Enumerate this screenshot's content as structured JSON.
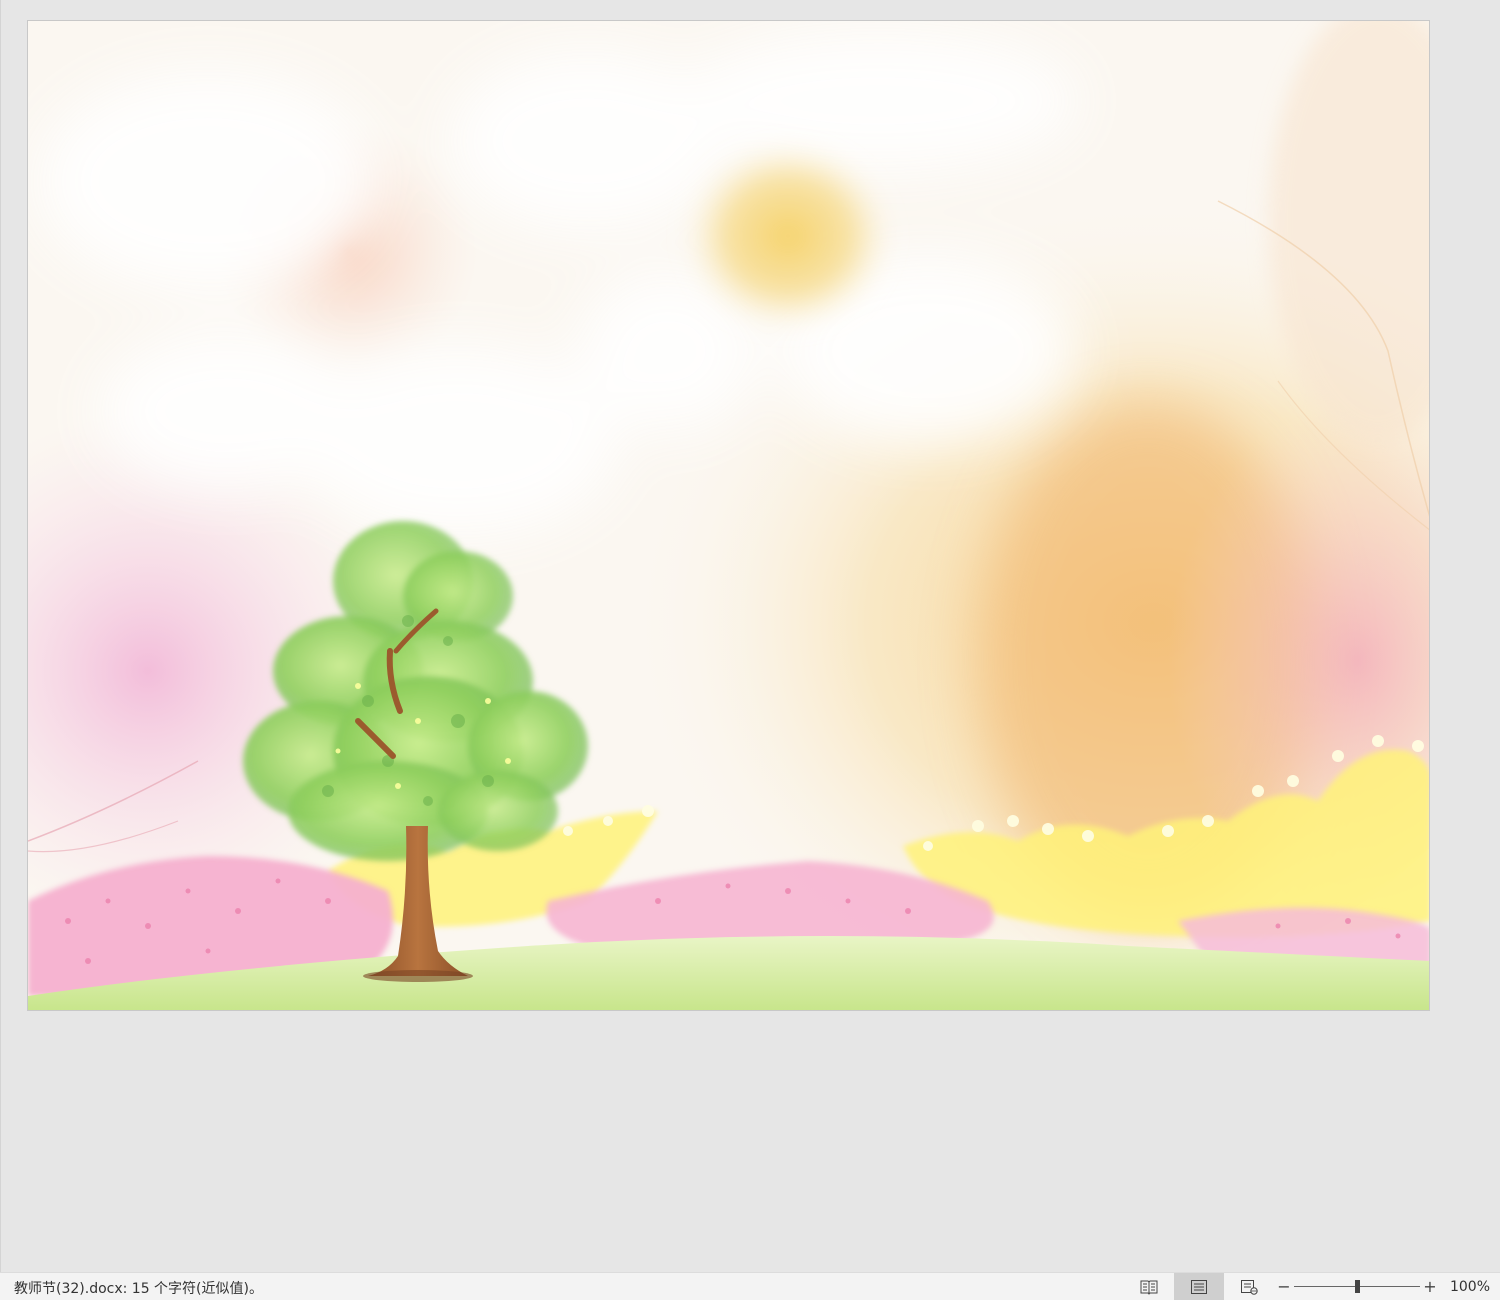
{
  "document": {
    "background_colors": {
      "sky_top": "#fbf8f4",
      "warm_glow": "#f6c98a",
      "pink_haze": "#f4b9d2",
      "grass": "#d9efae",
      "foliage": "#9fd66f",
      "trunk": "#a7663a",
      "yellow_shrubs": "#fff27a",
      "pink_flowers": "#f6b0cf"
    }
  },
  "statusbar": {
    "doc_info": "教师节(32).docx: 15 个字符(近似值)。",
    "zoom_label": "100%",
    "zoom_level": 0.5,
    "views": [
      {
        "name": "read-mode",
        "icon": "book-icon",
        "active": false
      },
      {
        "name": "print-layout",
        "icon": "page-lines-icon",
        "active": true
      },
      {
        "name": "web-layout",
        "icon": "web-page-icon",
        "active": false
      }
    ]
  }
}
